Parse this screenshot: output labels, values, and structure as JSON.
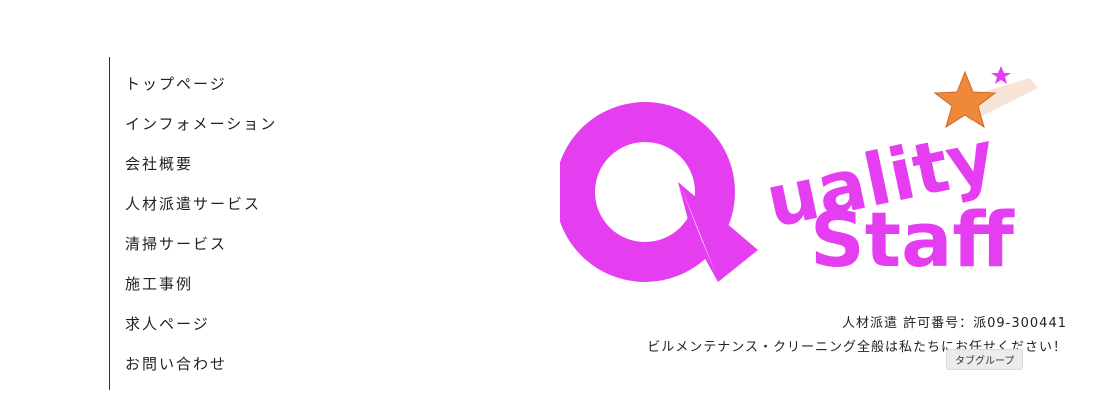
{
  "nav": {
    "items": [
      {
        "label": "トップページ"
      },
      {
        "label": "インフォメーション"
      },
      {
        "label": "会社概要"
      },
      {
        "label": "人材派遣サービス"
      },
      {
        "label": "清掃サービス"
      },
      {
        "label": "施工事例"
      },
      {
        "label": "求人ページ"
      },
      {
        "label": "お問い合わせ"
      }
    ]
  },
  "logo": {
    "line1": "uality",
    "line2": "Staff",
    "letter_q": "Q",
    "color": "#e53ef0",
    "star_color": "#f0883a"
  },
  "info": {
    "license": "人材派遣 許可番号：派09-300441",
    "tagline": "ビルメンテナンス・クリーニング全般は私たちにお任せください！"
  },
  "tooltip": {
    "label": "タブグループ"
  }
}
